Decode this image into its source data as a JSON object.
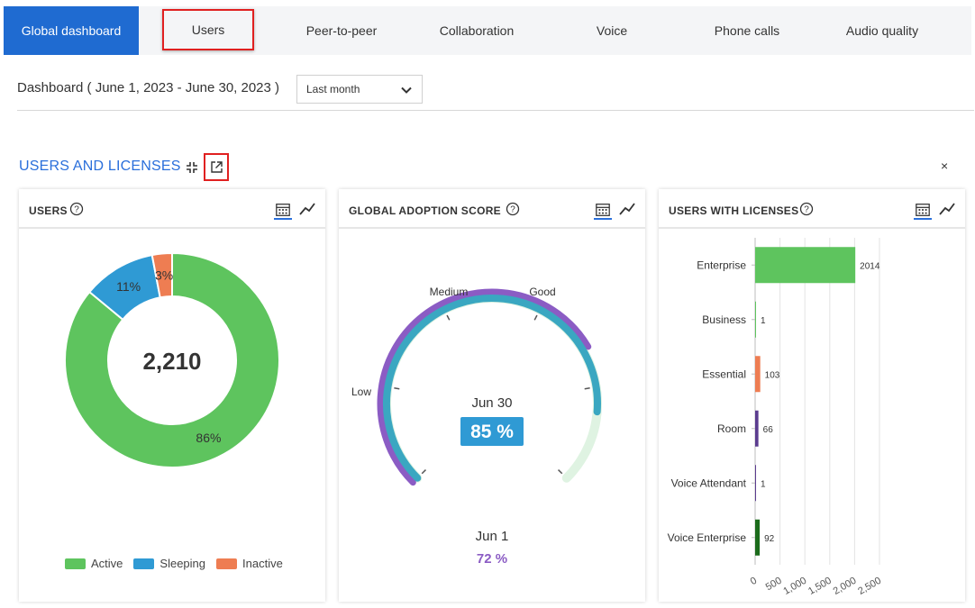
{
  "tabs": [
    {
      "label": "Global dashboard"
    },
    {
      "label": "Users"
    },
    {
      "label": "Peer-to-peer"
    },
    {
      "label": "Collaboration"
    },
    {
      "label": "Voice"
    },
    {
      "label": "Phone calls"
    },
    {
      "label": "Audio quality"
    }
  ],
  "dashboard": {
    "title": "Dashboard ( June 1, 2023 - June 30, 2023 )",
    "range_value": "Last month"
  },
  "section": {
    "title": "USERS AND LICENSES",
    "close": "×"
  },
  "colors": {
    "accent": "#1f6bd1",
    "active": "#5ec45e",
    "sleeping": "#2f9ad4",
    "inactive": "#ee7d52",
    "gauge_purple": "#8b5cc4",
    "gauge_teal": "#3aa7c1",
    "room": "#5b3c8f",
    "voice_enterprise": "#1b6b1b"
  },
  "users_card": {
    "title": "USERS",
    "total": "2,210",
    "slices": [
      {
        "label": "Active",
        "percent": 86,
        "text": "86%"
      },
      {
        "label": "Sleeping",
        "percent": 11,
        "text": "11%"
      },
      {
        "label": "Inactive",
        "percent": 3,
        "text": "3%"
      }
    ],
    "legend": [
      "Active",
      "Sleeping",
      "Inactive"
    ]
  },
  "adoption_card": {
    "title": "GLOBAL ADOPTION SCORE",
    "labels": {
      "low": "Low",
      "medium": "Medium",
      "good": "Good"
    },
    "current_date": "Jun 30",
    "current_score": "85 %",
    "current_value": 85,
    "previous_date": "Jun 1",
    "previous_score": "72 %",
    "previous_value": 72
  },
  "licenses_card": {
    "title": "USERS WITH LICENSES",
    "chart_data": {
      "type": "bar",
      "orientation": "horizontal",
      "categories": [
        "Enterprise",
        "Business",
        "Essential",
        "Room",
        "Voice Attendant",
        "Voice Enterprise"
      ],
      "values": [
        2014,
        1,
        103,
        66,
        1,
        92
      ],
      "xlim": [
        0,
        2500
      ],
      "xticks": [
        "0",
        "500",
        "1,000",
        "1,500",
        "2,000",
        "2,500"
      ],
      "grid": true
    }
  }
}
